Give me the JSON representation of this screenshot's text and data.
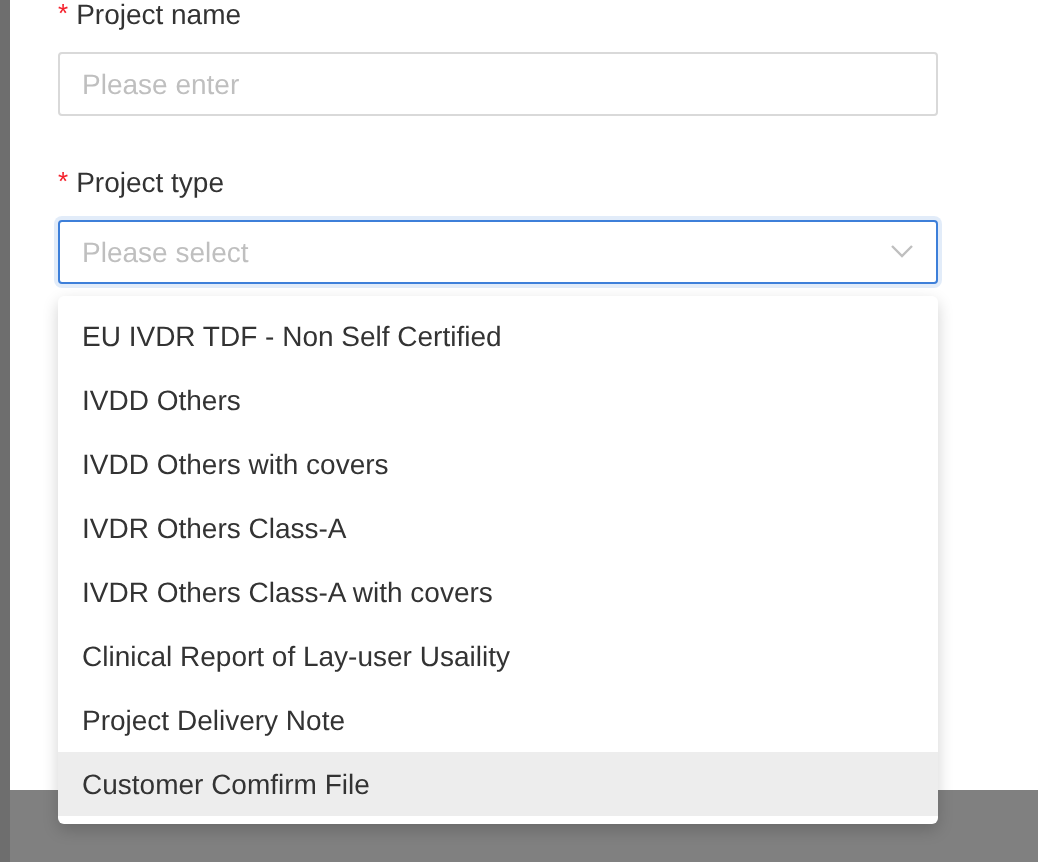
{
  "form": {
    "fields": [
      {
        "kind": "input",
        "label": "Project name",
        "required_mark": "*",
        "placeholder": "Please enter",
        "focused": false
      },
      {
        "kind": "select",
        "label": "Project type",
        "required_mark": "*",
        "placeholder": "Please select",
        "focused": true
      }
    ]
  },
  "dropdown": {
    "options": [
      {
        "label": "EU IVDR TDF - Non Self Certified",
        "hovered": false
      },
      {
        "label": "IVDD Others",
        "hovered": false
      },
      {
        "label": "IVDD Others with covers",
        "hovered": false
      },
      {
        "label": "IVDR Others Class-A",
        "hovered": false
      },
      {
        "label": "IVDR Others Class-A with covers",
        "hovered": false
      },
      {
        "label": "Clinical Report of Lay-user Usaility",
        "hovered": false
      },
      {
        "label": "Project Delivery Note",
        "hovered": false
      },
      {
        "label": "Customer Comfirm File",
        "hovered": true
      }
    ]
  }
}
